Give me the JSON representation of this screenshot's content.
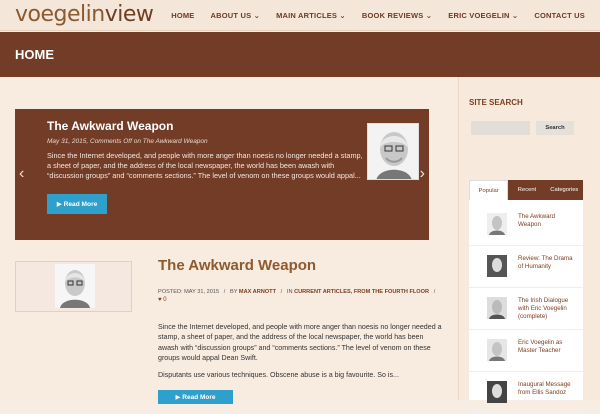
{
  "brand": {
    "part1": "voegelin",
    "part2": "view"
  },
  "nav": [
    {
      "label": "HOME"
    },
    {
      "label": "ABOUT US ⌄"
    },
    {
      "label": "MAIN ARTICLES ⌄"
    },
    {
      "label": "BOOK REVIEWS ⌄"
    },
    {
      "label": "ERIC VOEGELIN ⌄"
    },
    {
      "label": "CONTACT US"
    }
  ],
  "page_title": "HOME",
  "slider": {
    "title": "The Awkward Weapon",
    "meta": "May 31, 2015, Comments Off on The Awkward Weapon",
    "excerpt": "Since the Internet developed, and people with more anger than noesis no longer needed a stamp, a sheet of paper, and the address of the local newspaper, the world has been awash with “discussion groups” and “comments sections.” The level of venom on these groups would appal...",
    "button": "Read More",
    "left_arrow": "‹",
    "right_arrow": "›"
  },
  "post": {
    "title": "The Awkward Weapon",
    "meta": {
      "posted_label": "POSTED:",
      "date": "MAY 31, 2015",
      "separator": "/",
      "by_label": "BY",
      "author": "MAX ARNOTT",
      "in_label": "IN",
      "categories": "CURRENT ARTICLES, FROM THE FOURTH FLOOR"
    },
    "likes": "0",
    "body": "Since the Internet developed, and people with more anger than noesis no longer needed a stamp, a sheet of paper, and the address of the local newspaper, the world has been awash with “discussion groups” and “comments sections.” The level of venom on these groups would appal Dean Swift.",
    "body2": "Disputants use various techniques. Obscene abuse is a big favourite. So is...",
    "button": "Read More"
  },
  "sidebar": {
    "site_search_title": "SITE SEARCH",
    "search_button": "Search",
    "tabs": [
      {
        "label": "Popular"
      },
      {
        "label": "Recent"
      },
      {
        "label": "Categories"
      }
    ],
    "list": [
      {
        "label": "The Awkward Weapon"
      },
      {
        "label": "Review: The Drama of Humanity"
      },
      {
        "label": "The Irish Dialogue with Eric Voegelin (complete)"
      },
      {
        "label": "Eric Voegelin as Master Teacher"
      },
      {
        "label": "Inaugural Message from Ellis Sandoz"
      }
    ]
  },
  "colors": {
    "brown": "#733c27",
    "blue_button": "#2f9fcb"
  },
  "icons": [
    "arrow-left-icon",
    "arrow-right-icon",
    "heart-icon",
    "read-more-arrow-icon",
    "avatar-icon"
  ]
}
